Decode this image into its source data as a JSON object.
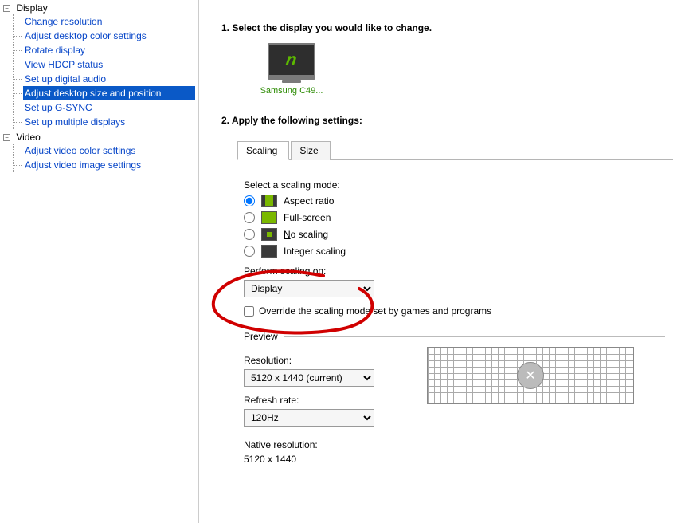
{
  "sidebar": {
    "nodes": [
      {
        "label": "Display",
        "children": [
          "Change resolution",
          "Adjust desktop color settings",
          "Rotate display",
          "View HDCP status",
          "Set up digital audio",
          "Adjust desktop size and position",
          "Set up G-SYNC",
          "Set up multiple displays"
        ],
        "selected_index": 5
      },
      {
        "label": "Video",
        "children": [
          "Adjust video color settings",
          "Adjust video image settings"
        ]
      }
    ]
  },
  "main": {
    "step1_header": "1. Select the display you would like to change.",
    "display_label": "Samsung C49...",
    "step2_header": "2. Apply the following settings:",
    "tabs": {
      "scaling": "Scaling",
      "size": "Size",
      "active": "scaling"
    },
    "scaling": {
      "select_label": "Select a scaling mode:",
      "modes": {
        "aspect": "Aspect ratio",
        "full": "Full-screen",
        "noscale": "No scaling",
        "integer": "Integer scaling"
      },
      "selected_mode": "aspect",
      "perform_label": "Perform scaling on:",
      "perform_value": "Display",
      "override_label": "Override the scaling mode set by games and programs",
      "override_checked": false,
      "preview_label": "Preview",
      "resolution_label": "Resolution:",
      "resolution_value": "5120 x 1440 (current)",
      "refresh_label": "Refresh rate:",
      "refresh_value": "120Hz",
      "native_label": "Native resolution:",
      "native_value": "5120 x 1440"
    }
  }
}
